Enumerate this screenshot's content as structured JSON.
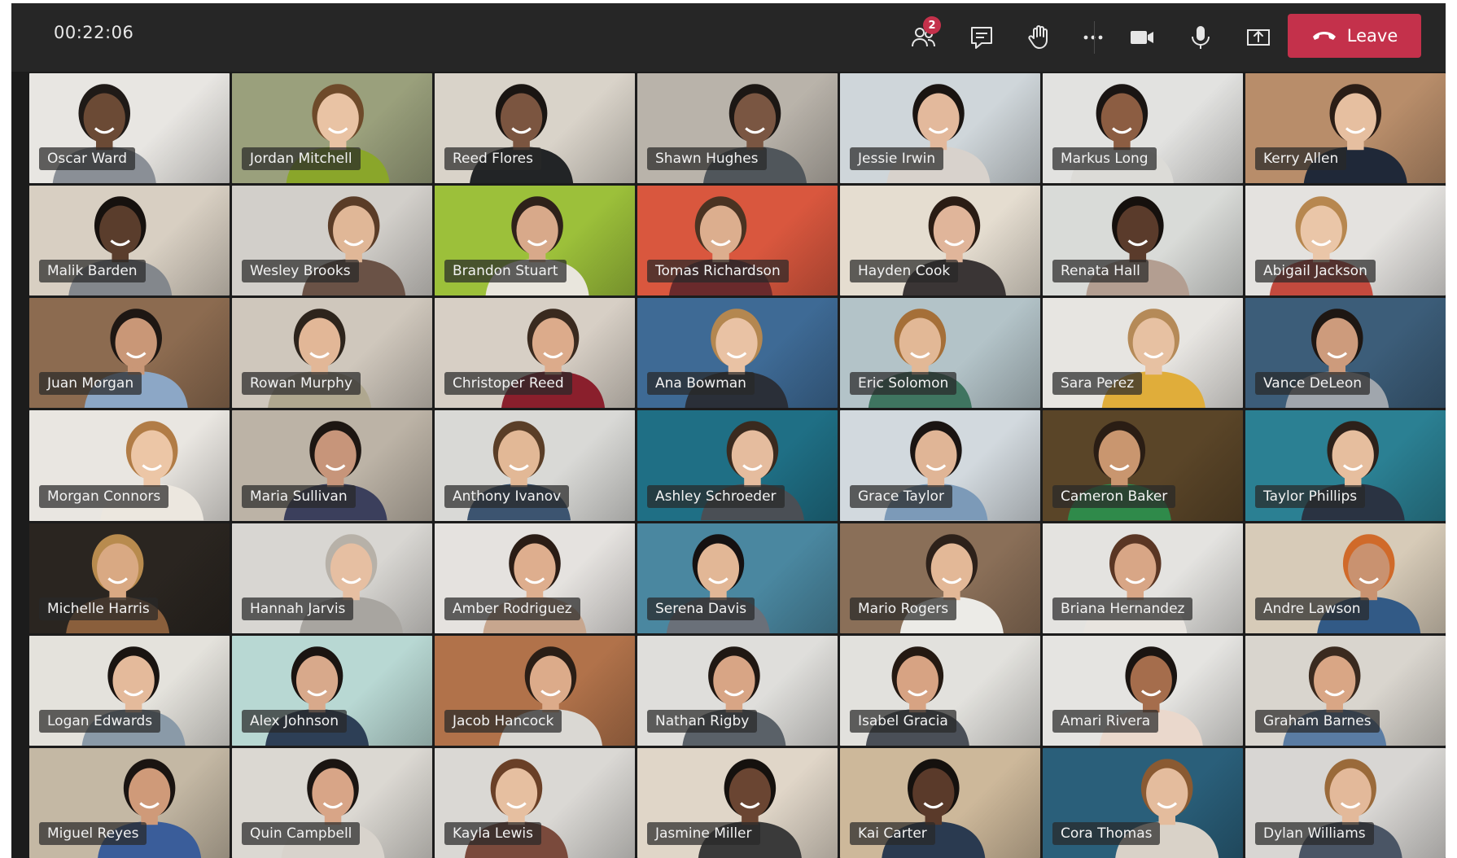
{
  "meeting": {
    "timer": "00:22:06",
    "participants_badge": "2",
    "leave_label": "Leave"
  },
  "icons": {
    "participants": "people-icon",
    "chat": "chat-icon",
    "raise_hand": "hand-icon",
    "more": "more-icon",
    "camera": "camera-icon",
    "mic": "mic-icon",
    "share": "share-icon",
    "leave": "phone-hangup-icon"
  },
  "colors": {
    "leave": "#c4314b",
    "topbar": "#262626"
  },
  "participants": [
    {
      "name": "Oscar Ward",
      "bg": "#e8e6e2",
      "shirt": "#8a8f96",
      "skin": "#6b4a35",
      "hair": "#1f1a17"
    },
    {
      "name": "Jordan Mitchell",
      "bg": "#9aa07c",
      "shirt": "#8aa62a",
      "skin": "#e9c3a4",
      "hair": "#6e4a2a"
    },
    {
      "name": "Reed Flores",
      "bg": "#d9d3c9",
      "shirt": "#222426",
      "skin": "#7b5540",
      "hair": "#1a1512"
    },
    {
      "name": "Shawn Hughes",
      "bg": "#b9b3aa",
      "shirt": "#50565b",
      "skin": "#7a5642",
      "hair": "#1c1714"
    },
    {
      "name": "Jessie Irwin",
      "bg": "#cfd6da",
      "shirt": "#d8d2cc",
      "skin": "#e3b99c",
      "hair": "#1a1411"
    },
    {
      "name": "Markus Long",
      "bg": "#e2e2e0",
      "shirt": "#dcdbd7",
      "skin": "#8c5d42",
      "hair": "#1a1513"
    },
    {
      "name": "Kerry Allen",
      "bg": "#b88d6a",
      "shirt": "#1f2838",
      "skin": "#e6bfa0",
      "hair": "#2a1d16"
    },
    {
      "name": "Malik Barden",
      "bg": "#d8cfc2",
      "shirt": "#83878c",
      "skin": "#5a3d2c",
      "hair": "#16110e"
    },
    {
      "name": "Wesley Brooks",
      "bg": "#d2cfca",
      "shirt": "#6a5246",
      "skin": "#e0b797",
      "hair": "#5a3c27"
    },
    {
      "name": "Brandon Stuart",
      "bg": "#9cc03a",
      "shirt": "#e9e6dd",
      "skin": "#d8a98a",
      "hair": "#2e211a"
    },
    {
      "name": "Tomas Richardson",
      "bg": "#d9573e",
      "shirt": "#6a2a2c",
      "skin": "#dcae8e",
      "hair": "#4a3322"
    },
    {
      "name": "Hayden Cook",
      "bg": "#e5ddd0",
      "shirt": "#3a3535",
      "skin": "#e0b59a",
      "hair": "#2a1c14"
    },
    {
      "name": "Renata Hall",
      "bg": "#d9dbd8",
      "shirt": "#b39e91",
      "skin": "#5a3b2b",
      "hair": "#15100d"
    },
    {
      "name": "Abigail Jackson",
      "bg": "#e4e2df",
      "shirt": "#c34a3e",
      "skin": "#eac6a8",
      "hair": "#b7874f"
    },
    {
      "name": "Juan Morgan",
      "bg": "#8c6b50",
      "shirt": "#8ca7c6",
      "skin": "#c99777",
      "hair": "#1e1713"
    },
    {
      "name": "Rowan Murphy",
      "bg": "#cfc7bc",
      "shirt": "#afa78f",
      "skin": "#e2b797",
      "hair": "#2d241c"
    },
    {
      "name": "Christoper Reed",
      "bg": "#d7cfc5",
      "shirt": "#8a1f2c",
      "skin": "#dcab8b",
      "hair": "#3a2a1f"
    },
    {
      "name": "Ana Bowman",
      "bg": "#3e6a95",
      "shirt": "#2a2f38",
      "skin": "#e9c2a4",
      "hair": "#b48750"
    },
    {
      "name": "Eric Solomon",
      "bg": "#b3c3c8",
      "shirt": "#3f7560",
      "skin": "#e2b896",
      "hair": "#a56f38"
    },
    {
      "name": "Sara Perez",
      "bg": "#e7e5e1",
      "shirt": "#e0ad3a",
      "skin": "#e7c1a2",
      "hair": "#b58a58"
    },
    {
      "name": "Vance DeLeon",
      "bg": "#3c5d79",
      "shirt": "#a0a6ad",
      "skin": "#cd9b7c",
      "hair": "#1e1713"
    },
    {
      "name": "Morgan Connors",
      "bg": "#e9e6e1",
      "shirt": "#ece7df",
      "skin": "#ecc6a6",
      "hair": "#b17c46"
    },
    {
      "name": "Maria Sullivan",
      "bg": "#bcb3a6",
      "shirt": "#3b3f5c",
      "skin": "#c7957a",
      "hair": "#1d1612"
    },
    {
      "name": "Anthony Ivanov",
      "bg": "#d9d9d6",
      "shirt": "#3c5470",
      "skin": "#e2b896",
      "hair": "#5a3e27"
    },
    {
      "name": "Ashley Schroeder",
      "bg": "#1f6f85",
      "shirt": "#4a4f55",
      "skin": "#e5bc9e",
      "hair": "#3a2a1f"
    },
    {
      "name": "Grace Taylor",
      "bg": "#d2d9de",
      "shirt": "#7c9ab8",
      "skin": "#e0b596",
      "hair": "#1a1412"
    },
    {
      "name": "Cameron Baker",
      "bg": "#5a4528",
      "shirt": "#2f8a4a",
      "skin": "#c9966f",
      "hair": "#2a1d14"
    },
    {
      "name": "Taylor Phillips",
      "bg": "#2b8093",
      "shirt": "#2a3342",
      "skin": "#e6be9e",
      "hair": "#2d211a"
    },
    {
      "name": "Michelle Harris",
      "bg": "#2a2520",
      "shirt": "#8a5f3c",
      "skin": "#d9a983",
      "hair": "#b88b4e"
    },
    {
      "name": "Hannah Jarvis",
      "bg": "#d8d6d2",
      "shirt": "#a8a5a0",
      "skin": "#e6bfa2",
      "hair": "#b7b1a8"
    },
    {
      "name": "Amber Rodriguez",
      "bg": "#e5e2df",
      "shirt": "#c7a68e",
      "skin": "#deae8e",
      "hair": "#2a1c15"
    },
    {
      "name": "Serena Davis",
      "bg": "#4a87a0",
      "shirt": "#6a7079",
      "skin": "#e2b796",
      "hair": "#151111"
    },
    {
      "name": "Mario Rogers",
      "bg": "#8a6f58",
      "shirt": "#ecebe7",
      "skin": "#e3b897",
      "hair": "#2d211a"
    },
    {
      "name": "Briana Hernandez",
      "bg": "#e4e3e0",
      "shirt": "#e8e4df",
      "skin": "#d8a686",
      "hair": "#5a3624"
    },
    {
      "name": "Andre Lawson",
      "bg": "#d7cbb8",
      "shirt": "#325a86",
      "skin": "#c99270",
      "hair": "#d06a2a"
    },
    {
      "name": "Logan Edwards",
      "bg": "#e4e2dc",
      "shirt": "#8a9aa8",
      "skin": "#e4ba9b",
      "hair": "#1a1411"
    },
    {
      "name": "Alex Johnson",
      "bg": "#b8d8d3",
      "shirt": "#2d3f56",
      "skin": "#d8a98b",
      "hair": "#1a1411"
    },
    {
      "name": "Jacob Hancock",
      "bg": "#b1724a",
      "shirt": "#dad8d3",
      "skin": "#dcab8a",
      "hair": "#2a1e16"
    },
    {
      "name": "Nathan Rigby",
      "bg": "#dfdedb",
      "shirt": "#5a6168",
      "skin": "#d8a585",
      "hair": "#201813"
    },
    {
      "name": "Isabel Gracia",
      "bg": "#e2e1dd",
      "shirt": "#4a4f57",
      "skin": "#d7a383",
      "hair": "#241912"
    },
    {
      "name": "Amari Rivera",
      "bg": "#e5e4e1",
      "shirt": "#ead8cc",
      "skin": "#a56d4c",
      "hair": "#1a1411"
    },
    {
      "name": "Graham Barnes",
      "bg": "#d9d5ce",
      "shirt": "#5a7ca3",
      "skin": "#d9a685",
      "hair": "#3a2a1f"
    },
    {
      "name": "Miguel Reyes",
      "bg": "#c4b8a4",
      "shirt": "#3a5d9a",
      "skin": "#cf9a79",
      "hair": "#1a1411"
    },
    {
      "name": "Quin Campbell",
      "bg": "#dbd8d2",
      "shirt": "#d8d3cc",
      "skin": "#d8a587",
      "hair": "#1b1512"
    },
    {
      "name": "Kayla Lewis",
      "bg": "#dad8d4",
      "shirt": "#7a4a3c",
      "skin": "#e6bfa0",
      "hair": "#6a4027"
    },
    {
      "name": "Jasmine Miller",
      "bg": "#e0d6c8",
      "shirt": "#3a3a3a",
      "skin": "#6a4532",
      "hair": "#15110e"
    },
    {
      "name": "Kai Carter",
      "bg": "#cdb89a",
      "shirt": "#2a3a50",
      "skin": "#5a3a2a",
      "hair": "#15110e"
    },
    {
      "name": "Cora Thomas",
      "bg": "#2a5f7a",
      "shirt": "#d9d2c8",
      "skin": "#e4bc9d",
      "hair": "#8a5a32"
    },
    {
      "name": "Dylan Williams",
      "bg": "#d8d6d3",
      "shirt": "#4a5565",
      "skin": "#e3b99a",
      "hair": "#9a6a3a"
    }
  ]
}
